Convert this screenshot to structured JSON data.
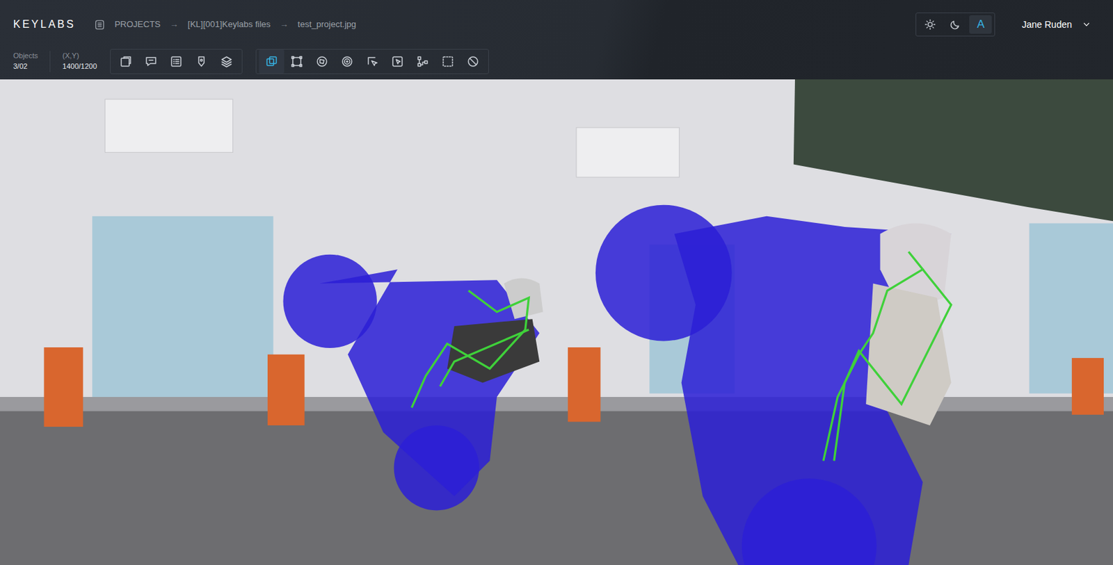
{
  "app": {
    "logo": "KEYLABS"
  },
  "breadcrumb": {
    "separator": "→",
    "items": [
      {
        "label": "PROJECTS"
      },
      {
        "label": "[KL][001]Keylabs files"
      },
      {
        "label": "test_project.jpg"
      }
    ]
  },
  "theme_switch": [
    {
      "kind": "sun",
      "selected": false
    },
    {
      "kind": "moon",
      "selected": false
    },
    {
      "kind": "text",
      "label": "A",
      "selected": true
    }
  ],
  "user": {
    "name": "Jane Ruden"
  },
  "stats": [
    {
      "label": "Objects",
      "value": "3/02"
    },
    {
      "label": "(X,Y)",
      "value": "1400/1200"
    }
  ],
  "toolbars": [
    {
      "tools": [
        {
          "selected": false
        },
        {
          "selected": false
        },
        {
          "selected": false
        },
        {
          "selected": false
        },
        {
          "selected": false
        }
      ]
    },
    {
      "tools": [
        {
          "selected": true
        },
        {
          "selected": false
        },
        {
          "selected": false
        },
        {
          "selected": false
        },
        {
          "selected": false
        },
        {
          "selected": false
        },
        {
          "selected": false
        },
        {
          "selected": false
        },
        {
          "selected": false
        }
      ]
    }
  ]
}
